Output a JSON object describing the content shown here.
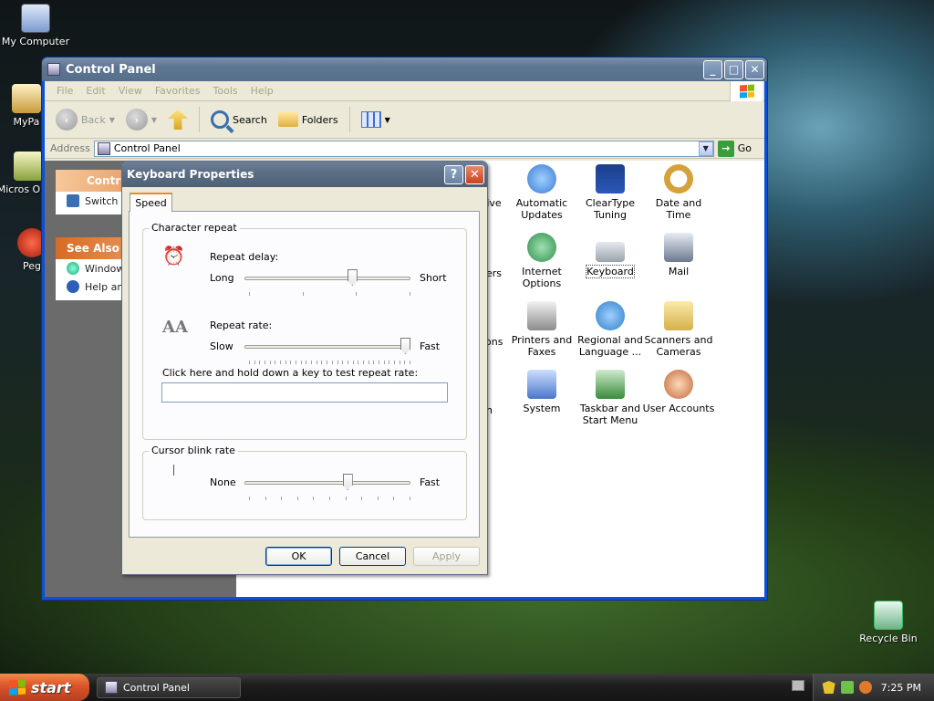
{
  "desktop": {
    "icons": [
      {
        "label": "My Computer"
      },
      {
        "label": "MyPa"
      },
      {
        "label": "Micros Outlo"
      },
      {
        "label": "Peg"
      },
      {
        "label": "Recycle Bin"
      }
    ]
  },
  "control_panel": {
    "title": "Control Panel",
    "menu": [
      "File",
      "Edit",
      "View",
      "Favorites",
      "Tools",
      "Help"
    ],
    "toolbar": {
      "back": "Back",
      "search": "Search",
      "folders": "Folders"
    },
    "address": {
      "label": "Address",
      "value": "Control Panel",
      "go": "Go"
    },
    "taskpane": {
      "header": "Contro",
      "switch_item": "Switch t",
      "see_also": "See Also",
      "see_also_items": [
        "Window",
        "Help an"
      ]
    },
    "partial_labels": [
      "tive",
      "ers",
      "ions",
      "n"
    ],
    "icons": [
      {
        "label": "Automatic Updates",
        "color": "#3a7bd5"
      },
      {
        "label": "ClearType Tuning",
        "color": "#2b58b8"
      },
      {
        "label": "Date and Time",
        "color": "#d4a13a"
      },
      {
        "label": "Internet Options",
        "color": "#2f8f4e"
      },
      {
        "label": "Keyboard",
        "color": "#9aa3ad"
      },
      {
        "label": "Mail",
        "color": "#6b7a8f"
      },
      {
        "label": "Printers and Faxes",
        "color": "#8b8b8b"
      },
      {
        "label": "Regional and Language ...",
        "color": "#2f7fc9"
      },
      {
        "label": "Scanners and Cameras",
        "color": "#d6b04a"
      },
      {
        "label": "System",
        "color": "#4a76c9"
      },
      {
        "label": "Taskbar and Start Menu",
        "color": "#3a8a3a"
      },
      {
        "label": "User Accounts",
        "color": "#c0683a"
      }
    ]
  },
  "dialog": {
    "title": "Keyboard Properties",
    "tab": "Speed",
    "character_repeat": {
      "group_label": "Character repeat",
      "repeat_delay_label": "Repeat delay:",
      "delay_min": "Long",
      "delay_max": "Short",
      "delay_value": 0.66,
      "repeat_rate_label": "Repeat rate:",
      "rate_min": "Slow",
      "rate_max": "Fast",
      "rate_value": 1.0,
      "test_label": "Click here and hold down a key to test repeat rate:",
      "test_value": ""
    },
    "cursor_blink": {
      "group_label": "Cursor blink rate",
      "min": "None",
      "max": "Fast",
      "value": 0.63
    },
    "buttons": {
      "ok": "OK",
      "cancel": "Cancel",
      "apply": "Apply"
    }
  },
  "taskbar": {
    "start": "start",
    "task": "Control Panel",
    "clock": "7:25 PM"
  }
}
